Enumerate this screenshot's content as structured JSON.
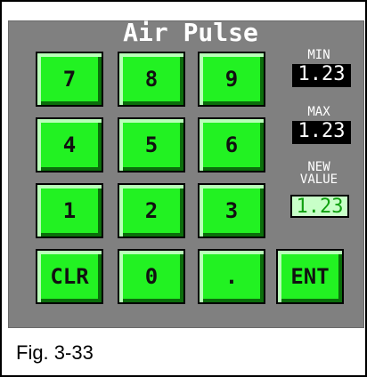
{
  "title": "Air Pulse",
  "keys": {
    "k7": "7",
    "k8": "8",
    "k9": "9",
    "k4": "4",
    "k5": "5",
    "k6": "6",
    "k1": "1",
    "k2": "2",
    "k3": "3",
    "clr": "CLR",
    "k0": "0",
    "dot": ".",
    "ent": "ENT"
  },
  "min_label": "MIN",
  "min_value": "1.23",
  "max_label": "MAX",
  "max_value": "1.23",
  "new_value_label_line1": "NEW",
  "new_value_label_line2": "VALUE",
  "new_value": "1.23",
  "caption": "Fig. 3-33",
  "colors": {
    "panel_bg": "#808080",
    "key_green": "#22f222",
    "value_green": "#10a010"
  }
}
